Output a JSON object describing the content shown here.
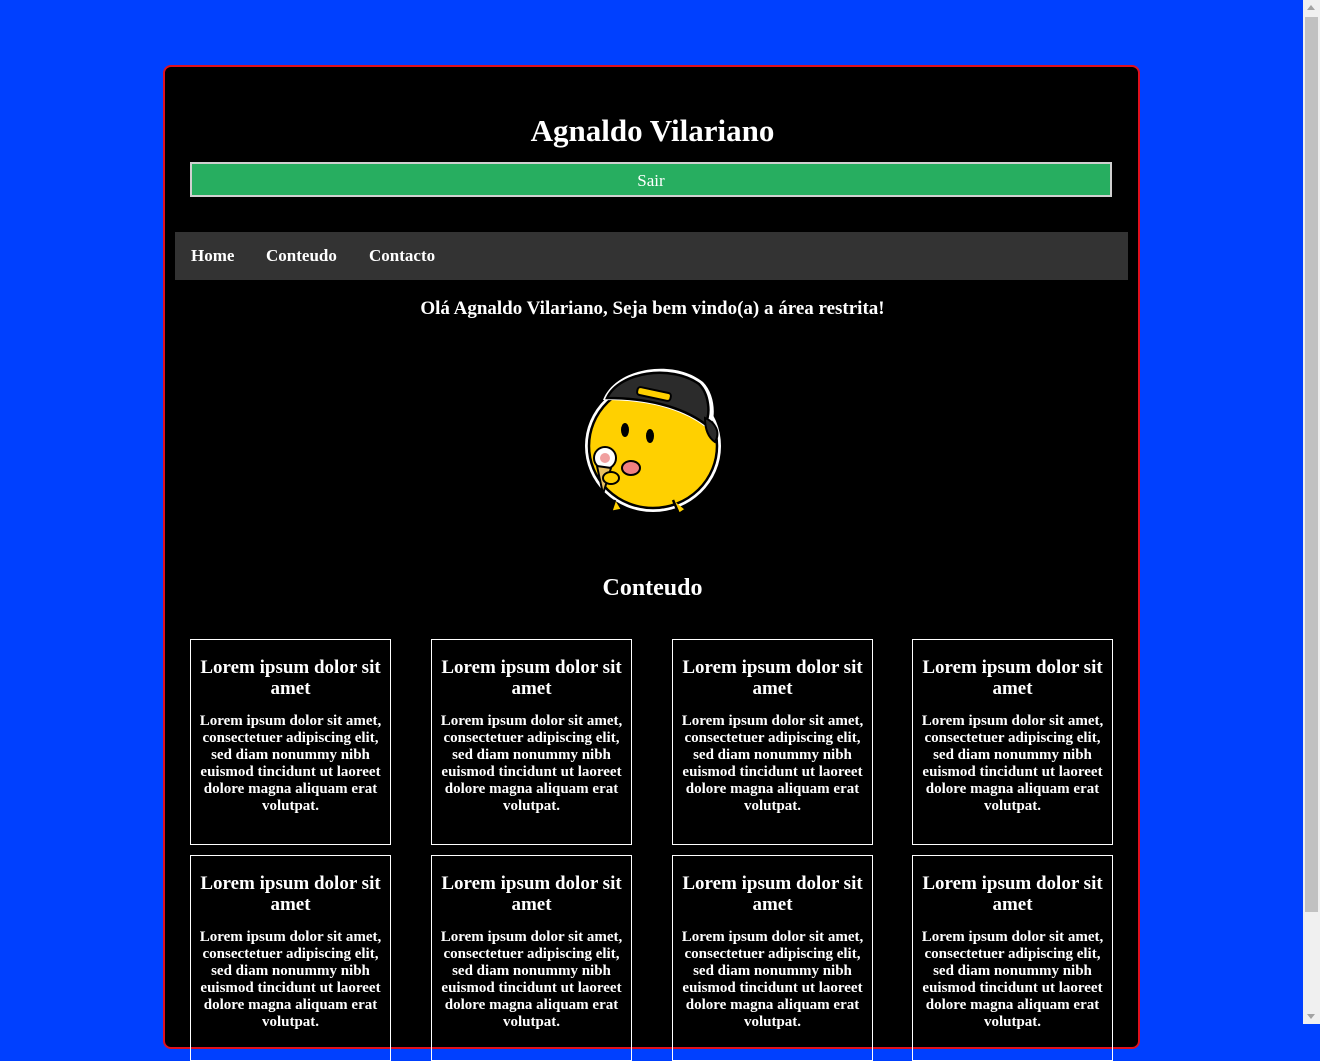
{
  "header": {
    "title": "Agnaldo Vilariano",
    "logout_label": "Sair"
  },
  "nav": {
    "items": [
      {
        "label": "Home"
      },
      {
        "label": "Conteudo"
      },
      {
        "label": "Contacto"
      }
    ]
  },
  "welcome": {
    "text": "Olá Agnaldo Vilariano, Seja bem vindo(a) a área restrita!",
    "image_icon": "mascot-yellow-chick-cap-icon"
  },
  "content": {
    "title": "Conteudo",
    "cards": [
      {
        "title": "Lorem ipsum dolor sit amet",
        "body": "Lorem ipsum dolor sit amet, consectetuer adipiscing elit, sed diam nonummy nibh euismod tincidunt ut laoreet dolore magna aliquam erat volutpat."
      },
      {
        "title": "Lorem ipsum dolor sit amet",
        "body": "Lorem ipsum dolor sit amet, consectetuer adipiscing elit, sed diam nonummy nibh euismod tincidunt ut laoreet dolore magna aliquam erat volutpat."
      },
      {
        "title": "Lorem ipsum dolor sit amet",
        "body": "Lorem ipsum dolor sit amet, consectetuer adipiscing elit, sed diam nonummy nibh euismod tincidunt ut laoreet dolore magna aliquam erat volutpat."
      },
      {
        "title": "Lorem ipsum dolor sit amet",
        "body": "Lorem ipsum dolor sit amet, consectetuer adipiscing elit, sed diam nonummy nibh euismod tincidunt ut laoreet dolore magna aliquam erat volutpat."
      },
      {
        "title": "Lorem ipsum dolor sit amet",
        "body": "Lorem ipsum dolor sit amet, consectetuer adipiscing elit, sed diam nonummy nibh euismod tincidunt ut laoreet dolore magna aliquam erat volutpat."
      },
      {
        "title": "Lorem ipsum dolor sit amet",
        "body": "Lorem ipsum dolor sit amet, consectetuer adipiscing elit, sed diam nonummy nibh euismod tincidunt ut laoreet dolore magna aliquam erat volutpat."
      },
      {
        "title": "Lorem ipsum dolor sit amet",
        "body": "Lorem ipsum dolor sit amet, consectetuer adipiscing elit, sed diam nonummy nibh euismod tincidunt ut laoreet dolore magna aliquam erat volutpat."
      },
      {
        "title": "Lorem ipsum dolor sit amet",
        "body": "Lorem ipsum dolor sit amet, consectetuer adipiscing elit, sed diam nonummy nibh euismod tincidunt ut laoreet dolore magna aliquam erat volutpat."
      }
    ]
  },
  "colors": {
    "page_background": "#0040ff",
    "panel_background": "#000000",
    "panel_border": "#e0101e",
    "logout_button": "#27ae60",
    "nav_background": "#333333"
  }
}
